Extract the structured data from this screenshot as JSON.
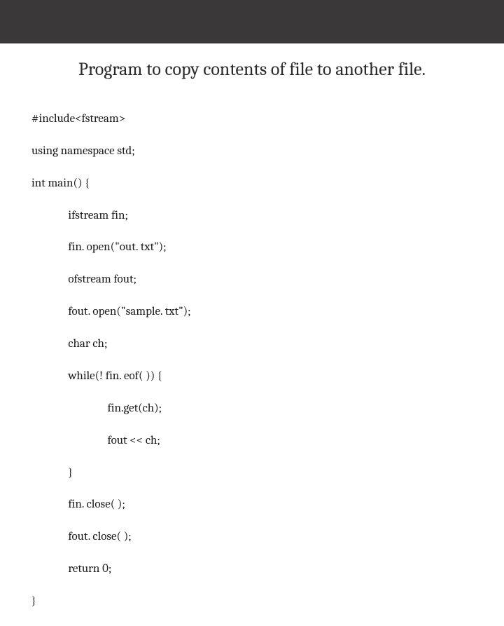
{
  "title": "Program to copy contents of file to another file.",
  "code": {
    "l1": "#include<fstream>",
    "l2": "using namespace std;",
    "l3": "int main() {",
    "l4": "              ifstream fin;",
    "l5": "              fin. open(\"out. txt\");",
    "l6": "              ofstream fout;",
    "l7": "              fout. open(\"sample. txt\");",
    "l8": "              char ch;",
    "l9": "              while(! fin. eof( )) {",
    "l10": "                             fin.get(ch);",
    "l11": "                             fout << ch;",
    "l12": "              }",
    "l13": "              fin. close( );",
    "l14": "              fout. close( );",
    "l15": "              return 0;",
    "l16": "}"
  }
}
